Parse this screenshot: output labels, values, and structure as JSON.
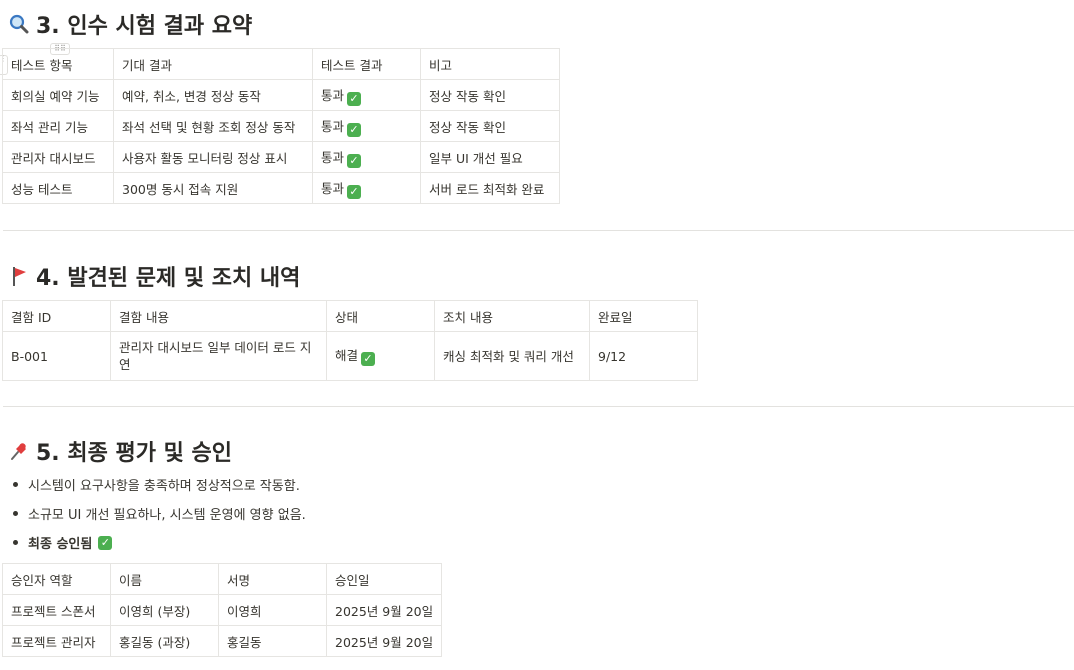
{
  "section3": {
    "title": "3. 인수 시험 결과 요약",
    "icon": "magnifier-icon",
    "headers": [
      "테스트 항목",
      "기대 결과",
      "테스트 결과",
      "비고"
    ],
    "rows": [
      [
        "회의실 예약 기능",
        "예약, 취소, 변경 정상 동작",
        "통과",
        "정상 작동 확인"
      ],
      [
        "좌석 관리 기능",
        "좌석 선택 및 현황 조회 정상 동작",
        "통과",
        "정상 작동 확인"
      ],
      [
        "관리자 대시보드",
        "사용자 활동 모니터링 정상 표시",
        "통과",
        "일부 UI 개선 필요"
      ],
      [
        "성능 테스트",
        "300명 동시 접속 지원",
        "통과",
        "서버 로드 최적화 완료"
      ]
    ]
  },
  "section4": {
    "title": "4. 발견된 문제 및 조치 내역",
    "icon": "red-flag-icon",
    "headers": [
      "결함 ID",
      "결함 내용",
      "상태",
      "조치 내용",
      "완료일"
    ],
    "rows": [
      [
        "B-001",
        "관리자 대시보드 일부 데이터 로드 지연",
        "해결",
        "캐싱 최적화 및 쿼리 개선",
        "9/12"
      ]
    ]
  },
  "section5": {
    "title": "5. 최종 평가 및 승인",
    "icon": "pushpin-icon",
    "bullets": [
      "시스템이 요구사항을 충족하며 정상적으로 작동함.",
      "소규모 UI 개선 필요하나, 시스템 운영에 영향 없음.",
      "최종 승인됨"
    ],
    "headers": [
      "승인자 역할",
      "이름",
      "서명",
      "승인일"
    ],
    "rows": [
      [
        "프로젝트 스폰서",
        "이영희 (부장)",
        "이영희",
        "2025년 9월 20일"
      ],
      [
        "프로젝트 관리자",
        "홍길동 (과장)",
        "홍길동",
        "2025년 9월 20일"
      ]
    ]
  },
  "colors": {
    "check": "#4caf50",
    "flag": "#e03e3e",
    "divider": "#e3e2df"
  }
}
